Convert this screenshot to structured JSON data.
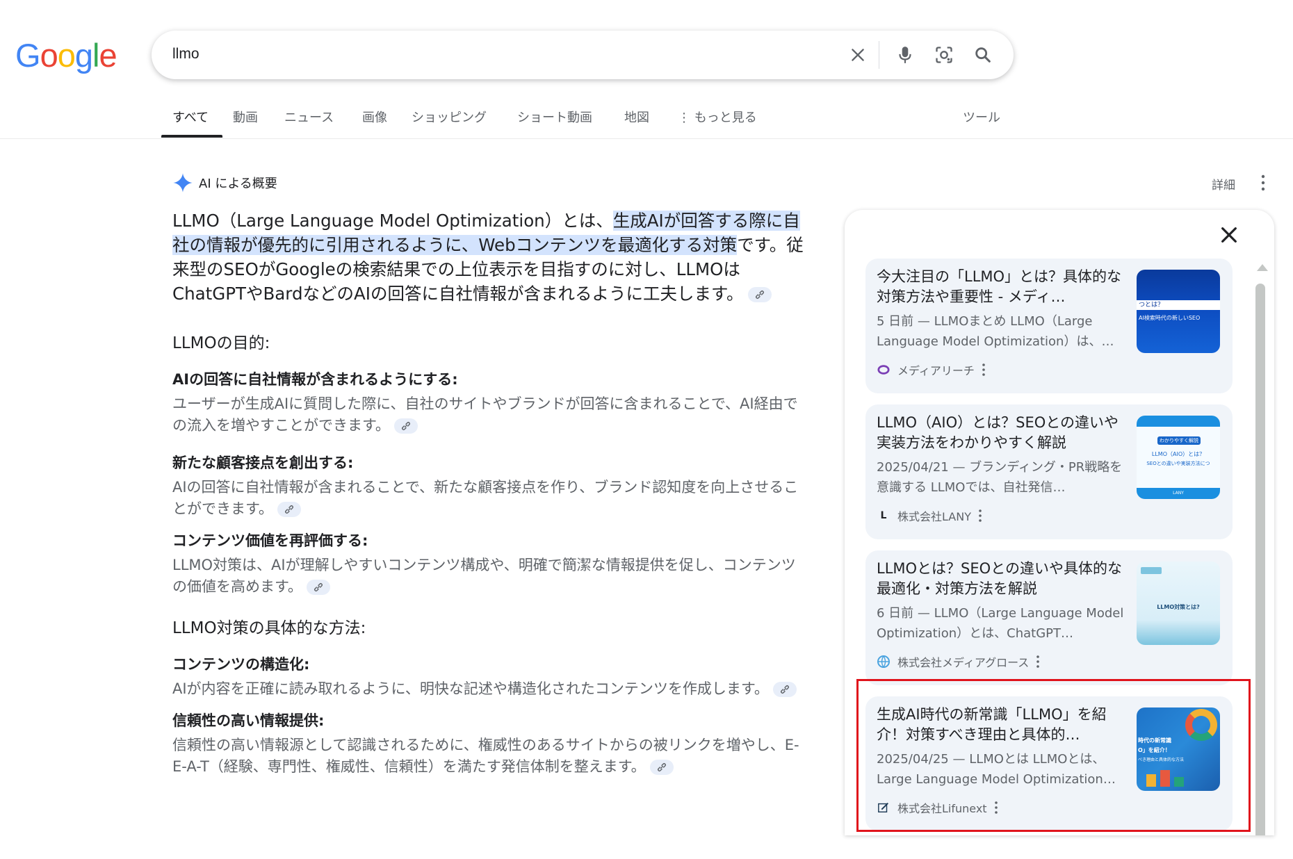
{
  "logo": {
    "letters": [
      "G",
      "o",
      "o",
      "g",
      "l",
      "e"
    ],
    "colors": [
      "#4285f4",
      "#ea4335",
      "#fbbc05",
      "#4285f4",
      "#34a853",
      "#ea4335"
    ]
  },
  "search": {
    "query": "llmo"
  },
  "tabs": [
    {
      "label": "すべて",
      "active": true
    },
    {
      "label": "動画"
    },
    {
      "label": "ニュース"
    },
    {
      "label": "画像"
    },
    {
      "label": "ショッピング"
    },
    {
      "label": "ショート動画"
    },
    {
      "label": "地図"
    },
    {
      "label": "⋮ もっと見る"
    },
    {
      "label": "ツール"
    }
  ],
  "ai_overview": {
    "header": "AI による概要",
    "details": "詳細",
    "intro_before": "LLMO（Large Language Model Optimization）とは、",
    "intro_highlight": "生成AIが回答する際に自社の情報が優先的に引用されるように、Webコンテンツを最適化する対策",
    "intro_after": "です。従来型のSEOがGoogleの検索結果での上位表示を目指すのに対し、LLMOはChatGPTやBardなどのAIの回答に自社情報が含まれるように工夫します。",
    "purpose_heading": "LLMOの目的:",
    "purposes": [
      {
        "title": "AIの回答に自社情報が含まれるようにする:",
        "text": "ユーザーが生成AIに質問した際に、自社のサイトやブランドが回答に含まれることで、AI経由での流入を増やすことができます。"
      },
      {
        "title": "新たな顧客接点を創出する:",
        "text": "AIの回答に自社情報が含まれることで、新たな顧客接点を作り、ブランド認知度を向上させることができます。"
      },
      {
        "title": "コンテンツ価値を再評価する:",
        "text": "LLMO対策は、AIが理解しやすいコンテンツ構成や、明確で簡潔な情報提供を促し、コンテンツの価値を高めます。"
      }
    ],
    "methods_heading": "LLMO対策の具体的な方法:",
    "methods": [
      {
        "title": "コンテンツの構造化:",
        "text": "AIが内容を正確に読み取れるように、明快な記述や構造化されたコンテンツを作成します。"
      },
      {
        "title": "信頼性の高い情報提供:",
        "text": "信頼性の高い情報源として認識されるために、権威性のあるサイトからの被リンクを増やし、E-E-A-T（経験、専門性、権威性、信頼性）を満たす発信体制を整えます。"
      }
    ]
  },
  "sources": [
    {
      "title": "今大注目の「LLMO」とは？具体的な対策方法や重要性 - メディ…",
      "snippet": "5 日前 — LLMOまとめ LLMO（Large Language Model Optimization）は、…",
      "site": "メディアリーチ",
      "favicon": "circle-logo-icon"
    },
    {
      "title": "LLMO（AIO）とは？SEOとの違いや実装方法をわかりやすく解説",
      "snippet": "2025/04/21 — ブランディング・PR戦略を意識する LLMOでは、自社発信…",
      "site": "株式会社LANY",
      "favicon_text": "L"
    },
    {
      "title": "LLMOとは？SEOとの違いや具体的な最適化・対策方法を解説",
      "snippet": "6 日前 — LLMO（Large Language Model Optimization）とは、ChatGPT…",
      "site": "株式会社メディアグロース",
      "favicon": "globe-logo-icon"
    },
    {
      "title": "生成AI時代の新常識「LLMO」を紹介！対策すべき理由と具体的…",
      "snippet": "2025/04/25 — LLMOとは LLMOとは、Large Language Model Optimization…",
      "site": "株式会社Lifunext",
      "favicon": "pen-logo-icon"
    }
  ],
  "thumbnails": [
    {
      "lines": [
        "つとは？",
        "AI検索時代の新しいSEO"
      ]
    },
    {
      "lines": [
        "わかりやすく解説",
        "LLMO（AIO）とは？",
        "SEOとの違いや実装方法につ",
        "LANY"
      ]
    },
    {
      "lines": [
        "LLMO対策とは?"
      ]
    },
    {
      "lines": [
        "時代の新常識",
        "O」を紹介！",
        "べき理由と具体的な方法"
      ]
    }
  ],
  "colors": {
    "highlight": "#d3e3fd",
    "card_bg": "#f0f4f9",
    "annotation_red": "#e0141c",
    "gemini_blue": "#4285f4"
  }
}
